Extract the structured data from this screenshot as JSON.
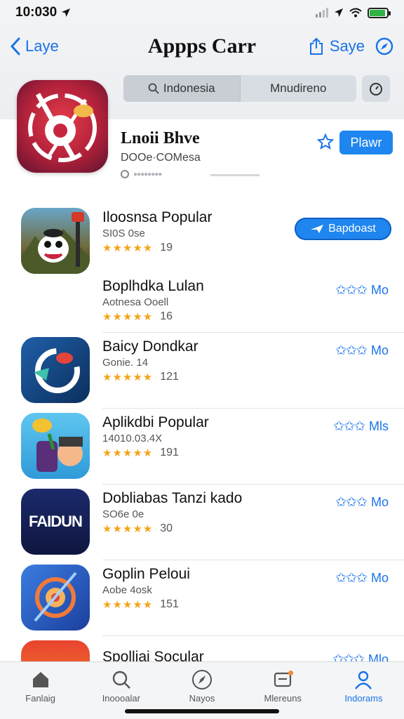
{
  "status": {
    "time": "10:030",
    "battery_level": 0.9,
    "battery_color": "#2fb344"
  },
  "nav": {
    "back_label": "Laye",
    "title": "Appps Carr",
    "share_label": "Saye",
    "back_icon": "chevron-left-icon",
    "share_icon": "share-icon",
    "compass_icon": "compass-icon"
  },
  "segment": {
    "tabs": [
      "Indonesia",
      "Mnudireno"
    ],
    "active": 0,
    "search_icon": "search-icon",
    "timer_icon": "timer-icon"
  },
  "featured": {
    "title": "Lnoii Bhve",
    "subtitle": "DOOe·COMesa",
    "meta": "●●●●●●●●",
    "button_label": "Plawr",
    "star_icon": "star-outline-icon"
  },
  "apps": [
    {
      "title": "Iloosnsa Popular",
      "subtitle": "SI0S 0se",
      "rating": "★★★★★",
      "count": "19",
      "action": "Bapdoast",
      "action_style": "pill"
    },
    {
      "title": "Boplhdka Lulan",
      "subtitle": "Aotnesa Ooell",
      "rating": "★★★★★",
      "count": "16",
      "action": "Mo",
      "action_style": "stars"
    },
    {
      "title": "Baicy Dondkar",
      "subtitle": "Gonie. 14",
      "rating": "★★★★★",
      "count": "121",
      "action": "Mo",
      "action_style": "stars"
    },
    {
      "title": "Aplikdbi Popular",
      "subtitle": "14010.03.4X",
      "rating": "★★★★★",
      "count": "191",
      "action": "Mls",
      "action_style": "stars"
    },
    {
      "title": "Dobliabas Tanzi kado",
      "subtitle": "SO6e 0e",
      "rating": "★★★★★",
      "count": "30",
      "action": "Mo",
      "action_style": "stars"
    },
    {
      "title": "Goplin Peloui",
      "subtitle": "Aobe 4osk",
      "rating": "★★★★★",
      "count": "151",
      "action": "Mo",
      "action_style": "stars"
    },
    {
      "title": "Spolliai Socular",
      "subtitle": "",
      "rating": "",
      "count": "",
      "action": "Mlo",
      "action_style": "stars"
    }
  ],
  "app_icon_texts": {
    "fandom": "FAIDUN"
  },
  "action_stars": "✩✩✩",
  "tabs": [
    {
      "label": "Fanlaig",
      "icon": "home-icon",
      "active": false
    },
    {
      "label": "Inoooalar",
      "icon": "search-icon",
      "active": false
    },
    {
      "label": "Nayos",
      "icon": "compass-icon",
      "active": false
    },
    {
      "label": "Mlereuns",
      "icon": "inbox-icon",
      "active": false
    },
    {
      "label": "Indorams",
      "icon": "person-icon",
      "active": true
    }
  ]
}
